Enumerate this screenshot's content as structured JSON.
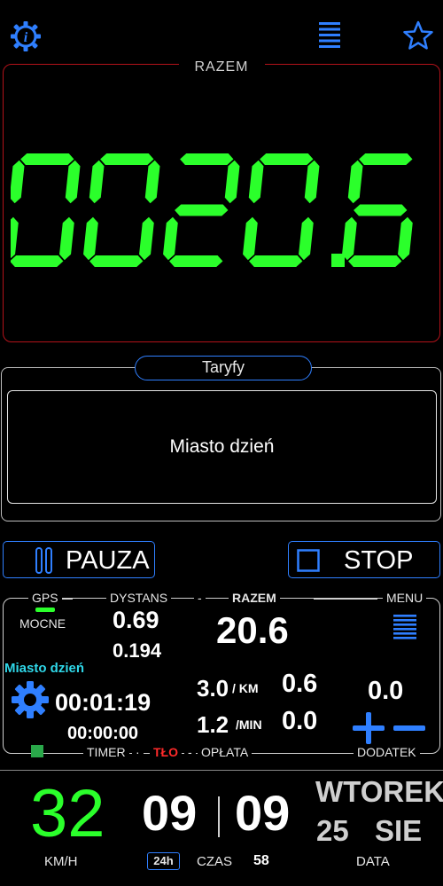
{
  "header": {
    "info_icon": "gear-info-icon",
    "menu_icon": "menu-icon",
    "favorite_icon": "star-icon"
  },
  "total": {
    "label": "RAZEM",
    "value": "0020.6",
    "digit_color": "#2bff2b"
  },
  "tariffs": {
    "title": "Taryfy",
    "selected": "Miasto dzień"
  },
  "actions": {
    "pause_label": "PAUZA",
    "stop_label": "STOP"
  },
  "info": {
    "gps_label": "GPS",
    "gps_signal": "MOCNE",
    "distance_label": "DYSTANS",
    "distance_main": "0.69",
    "distance_sub": "0.194",
    "total_label": "RAZEM",
    "total_value": "20.6",
    "menu_label": "MENU",
    "tariff_name": "Miasto dzień",
    "time_elapsed": "00:01:19",
    "time_idle": "00:00:00",
    "rate_km": "3.0",
    "rate_km_unit": "/ KM",
    "rate_min": "1.2",
    "rate_min_unit": "/MIN",
    "fare_km": "0.6",
    "fare_min": "0.0",
    "extra_value": "0.0",
    "timer_label": "TIMER",
    "background_label": "TŁO",
    "fare_label": "OPŁATA",
    "extra_label": "DODATEK"
  },
  "status": {
    "speed": "32",
    "speed_unit": "KM/H",
    "hour": "09",
    "minute": "09",
    "format_badge": "24h",
    "time_label": "CZAS",
    "seconds": "58",
    "weekday": "WTOREK",
    "day": "25",
    "month": "SIE",
    "date_label": "DATA"
  },
  "colors": {
    "accent_blue": "#2f7fff",
    "green": "#2bff2b",
    "red_border": "#b3121a",
    "cyan": "#2fd7e8"
  }
}
